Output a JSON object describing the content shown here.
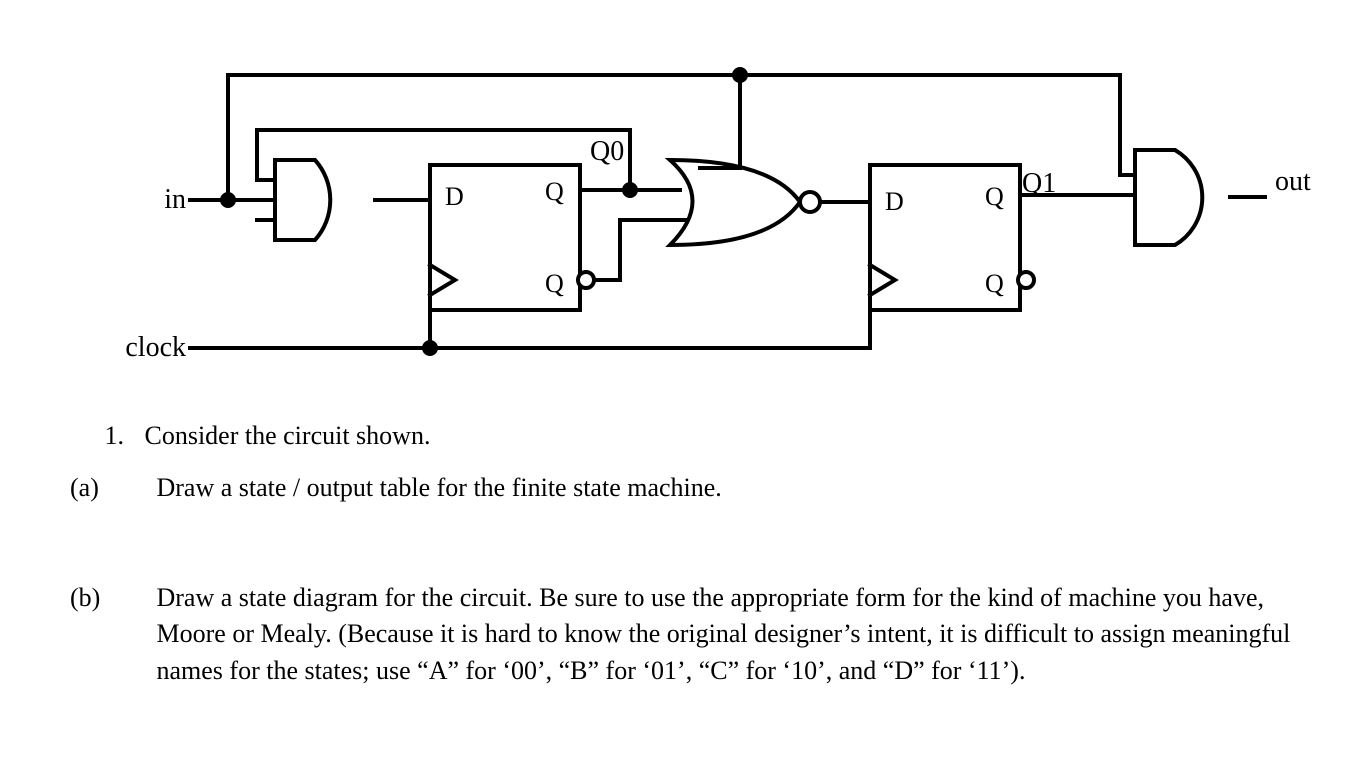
{
  "circuit": {
    "labels": {
      "in": "in",
      "clock": "clock",
      "out": "out",
      "Q0": "Q0",
      "Q1": "Q1",
      "D": "D",
      "Q": "Q",
      "Qbar": "Q"
    },
    "gates": [
      "AND",
      "NOR",
      "AND"
    ],
    "flipflops": [
      "D-FlipFlop-0",
      "D-FlipFlop-1"
    ]
  },
  "question": {
    "number": "1.",
    "stem": "Consider the circuit shown.",
    "parts": {
      "a": {
        "label": "(a)",
        "text": "Draw a state / output table for the finite state machine."
      },
      "b": {
        "label": "(b)",
        "text": "Draw a state diagram for the circuit.  Be sure to use the appropriate form for the kind of machine you have, Moore or Mealy.  (Because it is hard to know the original designer’s intent, it is difficult to assign meaningful names for the states; use “A” for ‘00’, “B” for ‘01’, “C” for ‘10’, and “D” for ‘11’)."
      }
    }
  }
}
